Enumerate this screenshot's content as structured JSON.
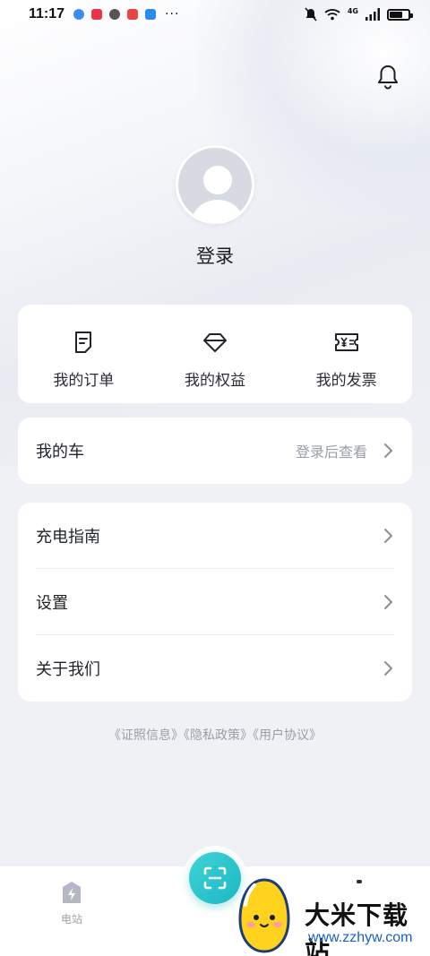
{
  "status_bar": {
    "time": "11:17",
    "network": "4G",
    "app_icons": [
      "browser-icon",
      "news-icon",
      "wechat-icon",
      "app-icon",
      "cloud-icon"
    ],
    "more": "···"
  },
  "profile": {
    "login_label": "登录"
  },
  "quick_actions": [
    {
      "label": "我的订单",
      "icon": "order-icon"
    },
    {
      "label": "我的权益",
      "icon": "diamond-icon"
    },
    {
      "label": "我的发票",
      "icon": "invoice-icon"
    }
  ],
  "my_car": {
    "label": "我的车",
    "hint": "登录后查看"
  },
  "menu": {
    "items": [
      {
        "label": "充电指南"
      },
      {
        "label": "设置"
      },
      {
        "label": "关于我们"
      }
    ]
  },
  "links": {
    "license": "《证照信息》",
    "privacy": "《隐私政策》",
    "agreement": "《用户协议》"
  },
  "tabbar": {
    "station_label": "电站"
  },
  "watermark": {
    "title": "大米下载站",
    "url": "www.zzhyw.com"
  },
  "colors": {
    "accent": "#1bb8c3",
    "muted_text": "#9a9ea6",
    "card_bg": "#ffffff",
    "page_bg": "#eff1f5"
  }
}
